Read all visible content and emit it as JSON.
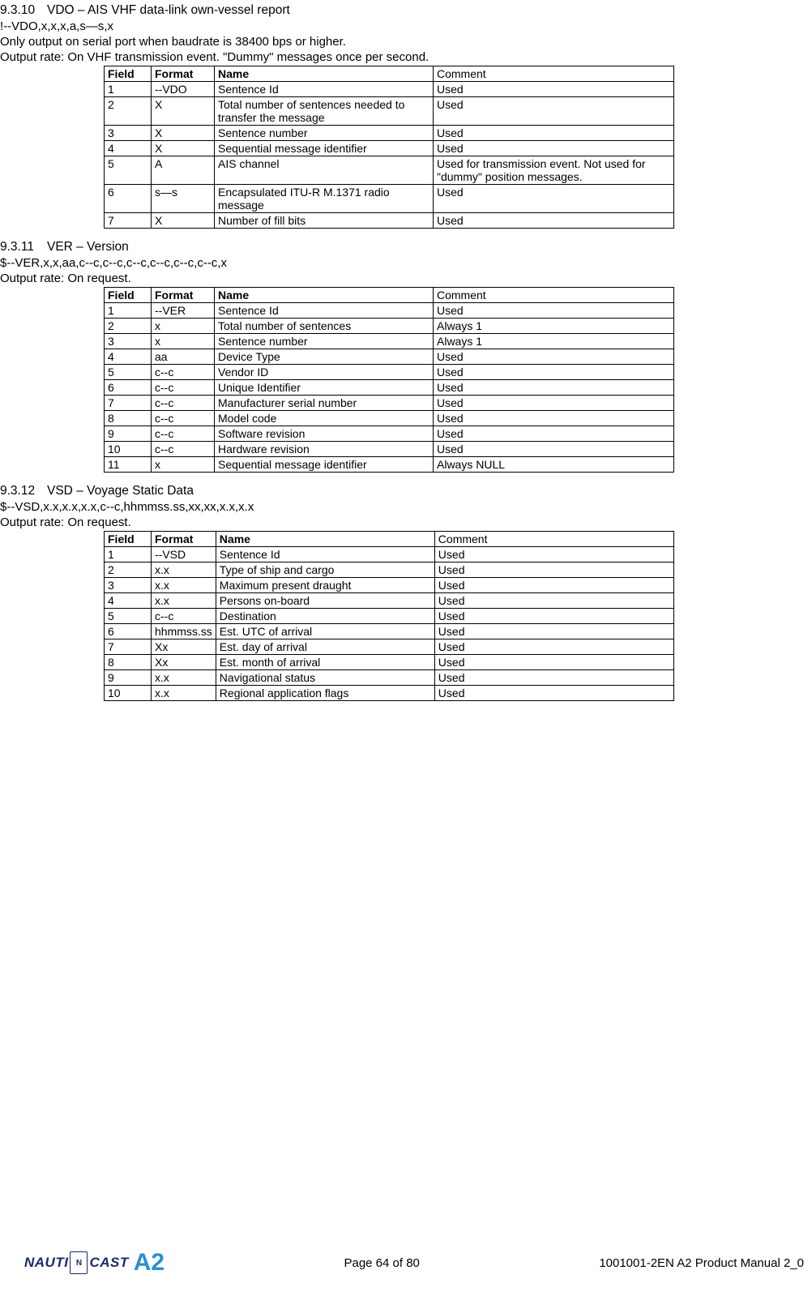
{
  "sections": [
    {
      "num": "9.3.10",
      "title": "VDO – AIS VHF data-link own-vessel report",
      "syntax": "!--VDO,x,x,x,a,s—s,x",
      "notes": [
        "Only output on serial port when baudrate is 38400 bps or higher."
      ],
      "rate": "Output rate: On VHF transmission event. \"Dummy\" messages once per second.",
      "table": {
        "headers": [
          "Field",
          "Format",
          "Name",
          "Comment"
        ],
        "rows": [
          {
            "field": "1",
            "format": "--VDO",
            "name": "Sentence Id",
            "comment": "Used"
          },
          {
            "field": "2",
            "format": "X",
            "name": "Total number of sentences needed to transfer the message",
            "name_just": true,
            "comment": "Used"
          },
          {
            "field": "3",
            "format": "X",
            "name": "Sentence number",
            "comment": "Used"
          },
          {
            "field": "4",
            "format": "X",
            "name": "Sequential message identifier",
            "comment": "Used"
          },
          {
            "field": "5",
            "format": "A",
            "name": "AIS channel",
            "comment": "Used for transmission event. Not used for \"dummy\" position messages.",
            "comment_just": true
          },
          {
            "field": "6",
            "format": "s—s",
            "name": "Encapsulated ITU-R M.1371 radio message",
            "name_just": true,
            "comment": "Used"
          },
          {
            "field": "7",
            "format": "X",
            "name": "Number of fill bits",
            "comment": "Used"
          }
        ]
      }
    },
    {
      "num": "9.3.11",
      "title": "VER – Version",
      "syntax": "$--VER,x,x,aa,c--c,c--c,c--c,c--c,c--c,c--c,x",
      "notes": [],
      "rate": "Output rate: On request.",
      "table": {
        "headers": [
          "Field",
          "Format",
          "Name",
          "Comment"
        ],
        "rows": [
          {
            "field": "1",
            "format": "--VER",
            "name": "Sentence Id",
            "comment": "Used"
          },
          {
            "field": "2",
            "format": "x",
            "name": "Total number of sentences",
            "comment": "Always 1"
          },
          {
            "field": "3",
            "format": "x",
            "name": "Sentence number",
            "comment": "Always 1"
          },
          {
            "field": "4",
            "format": "aa",
            "name": "Device Type",
            "comment": "Used"
          },
          {
            "field": "5",
            "format": "c--c",
            "name": "Vendor ID",
            "comment": "Used"
          },
          {
            "field": "6",
            "format": "c--c",
            "name": "Unique Identifier",
            "comment": "Used"
          },
          {
            "field": "7",
            "format": "c--c",
            "name": "Manufacturer serial number",
            "comment": "Used"
          },
          {
            "field": "8",
            "format": "c--c",
            "name": "Model code",
            "comment": "Used"
          },
          {
            "field": "9",
            "format": "c--c",
            "name": "Software revision",
            "comment": "Used"
          },
          {
            "field": "10",
            "format": "c--c",
            "name": "Hardware revision",
            "comment": "Used"
          },
          {
            "field": "11",
            "format": "x",
            "name": "Sequential message identifier",
            "comment": "Always NULL"
          }
        ]
      }
    },
    {
      "num": "9.3.12",
      "title": "VSD – Voyage Static Data",
      "syntax": "$--VSD,x.x,x.x,x.x,c--c,hhmmss.ss,xx,xx,x.x,x.x",
      "notes": [],
      "rate": "Output rate: On request.",
      "table": {
        "headers": [
          "Field",
          "Format",
          "Name",
          "Comment"
        ],
        "rows": [
          {
            "field": "1",
            "format": "--VSD",
            "name": "Sentence Id",
            "comment": "Used"
          },
          {
            "field": "2",
            "format": "x.x",
            "name": "Type of ship and cargo",
            "comment": "Used"
          },
          {
            "field": "3",
            "format": "x.x",
            "name": "Maximum present draught",
            "comment": "Used"
          },
          {
            "field": "4",
            "format": "x.x",
            "name": "Persons on-board",
            "comment": "Used"
          },
          {
            "field": "5",
            "format": "c--c",
            "name": "Destination",
            "comment": "Used"
          },
          {
            "field": "6",
            "format": "hhmmss.ss",
            "name": "Est. UTC of arrival",
            "comment": "Used"
          },
          {
            "field": "7",
            "format": "Xx",
            "name": "Est. day of arrival",
            "comment": "Used"
          },
          {
            "field": "8",
            "format": "Xx",
            "name": "Est. month of arrival",
            "comment": "Used"
          },
          {
            "field": "9",
            "format": "x.x",
            "name": "Navigational status",
            "comment": "Used"
          },
          {
            "field": "10",
            "format": "x.x",
            "name": "Regional application flags",
            "comment": "Used"
          }
        ]
      }
    }
  ],
  "footer": {
    "page": "Page 64 of 80",
    "doc": "1001001-2EN A2 Product Manual 2_0",
    "logo_nauti": "NAUTI",
    "logo_cast": "CAST",
    "logo_a2": "A2"
  }
}
